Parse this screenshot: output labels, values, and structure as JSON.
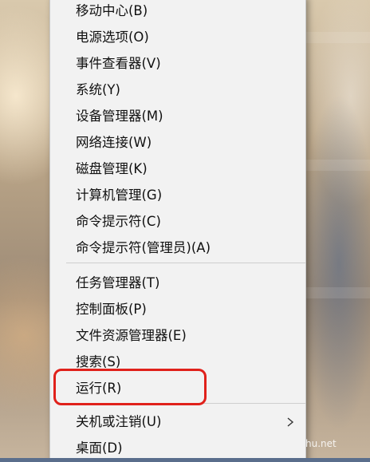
{
  "menu": {
    "items": [
      {
        "label": "移动中心(B)"
      },
      {
        "label": "电源选项(O)"
      },
      {
        "label": "事件查看器(V)"
      },
      {
        "label": "系统(Y)"
      },
      {
        "label": "设备管理器(M)"
      },
      {
        "label": "网络连接(W)"
      },
      {
        "label": "磁盘管理(K)"
      },
      {
        "label": "计算机管理(G)"
      },
      {
        "label": "命令提示符(C)"
      },
      {
        "label": "命令提示符(管理员)(A)"
      },
      {
        "label": "任务管理器(T)"
      },
      {
        "label": "控制面板(P)"
      },
      {
        "label": "文件资源管理器(E)"
      },
      {
        "label": "搜索(S)"
      },
      {
        "label": "运行(R)",
        "highlighted": true
      },
      {
        "label": "关机或注销(U)",
        "has_submenu": true
      },
      {
        "label": "桌面(D)"
      }
    ],
    "highlight_color": "#e0211b"
  },
  "watermark": {
    "text": "hu.net"
  }
}
